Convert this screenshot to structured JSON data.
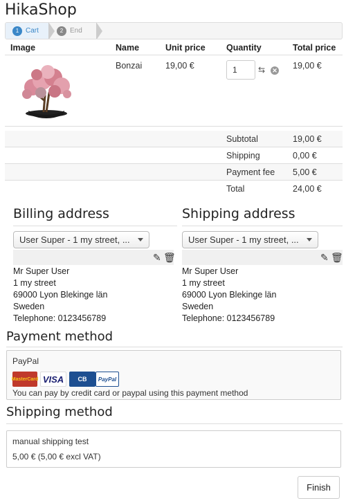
{
  "site": {
    "title": "HikaShop"
  },
  "steps": [
    {
      "num": "1",
      "label": "Cart",
      "active": true
    },
    {
      "num": "2",
      "label": "End",
      "active": false
    }
  ],
  "cart": {
    "headers": {
      "image": "Image",
      "name": "Name",
      "unit_price": "Unit price",
      "quantity": "Quantity",
      "total_price": "Total price"
    },
    "items": [
      {
        "name": "Bonzai",
        "unit_price": "19,00 €",
        "quantity": "1",
        "total_price": "19,00 €",
        "image": "bonsai-tree-image"
      }
    ],
    "totals": [
      {
        "label": "Subtotal",
        "value": "19,00 €"
      },
      {
        "label": "Shipping",
        "value": "0,00 €"
      },
      {
        "label": "Payment fee",
        "value": "5,00 €"
      },
      {
        "label": "Total",
        "value": "24,00 €"
      }
    ]
  },
  "billing": {
    "title": "Billing address",
    "selected": "User Super - 1 my street, ...",
    "lines": [
      "Mr Super User",
      "1 my street",
      "69000 Lyon Blekinge län",
      "Sweden",
      "Telephone: 0123456789"
    ]
  },
  "shipping_address": {
    "title": "Shipping address",
    "selected": "User Super - 1 my street, ...",
    "lines": [
      "Mr Super User",
      "1 my street",
      "69000 Lyon Blekinge län",
      "Sweden",
      "Telephone: 0123456789"
    ]
  },
  "payment": {
    "title": "Payment method",
    "name": "PayPal",
    "description": "You can pay by credit card or paypal using this payment method",
    "cards": [
      "MasterCard",
      "VISA",
      "CB",
      "PayPal"
    ]
  },
  "shipping_method": {
    "title": "Shipping method",
    "name": "manual shipping test",
    "price": "5,00 € (5,00 € excl VAT)"
  },
  "actions": {
    "finish": "Finish"
  },
  "icons": {
    "refresh": "refresh-icon",
    "remove": "remove-icon",
    "edit": "pencil-icon",
    "delete": "trash-icon"
  },
  "colors": {
    "accent": "#3a87c8"
  }
}
